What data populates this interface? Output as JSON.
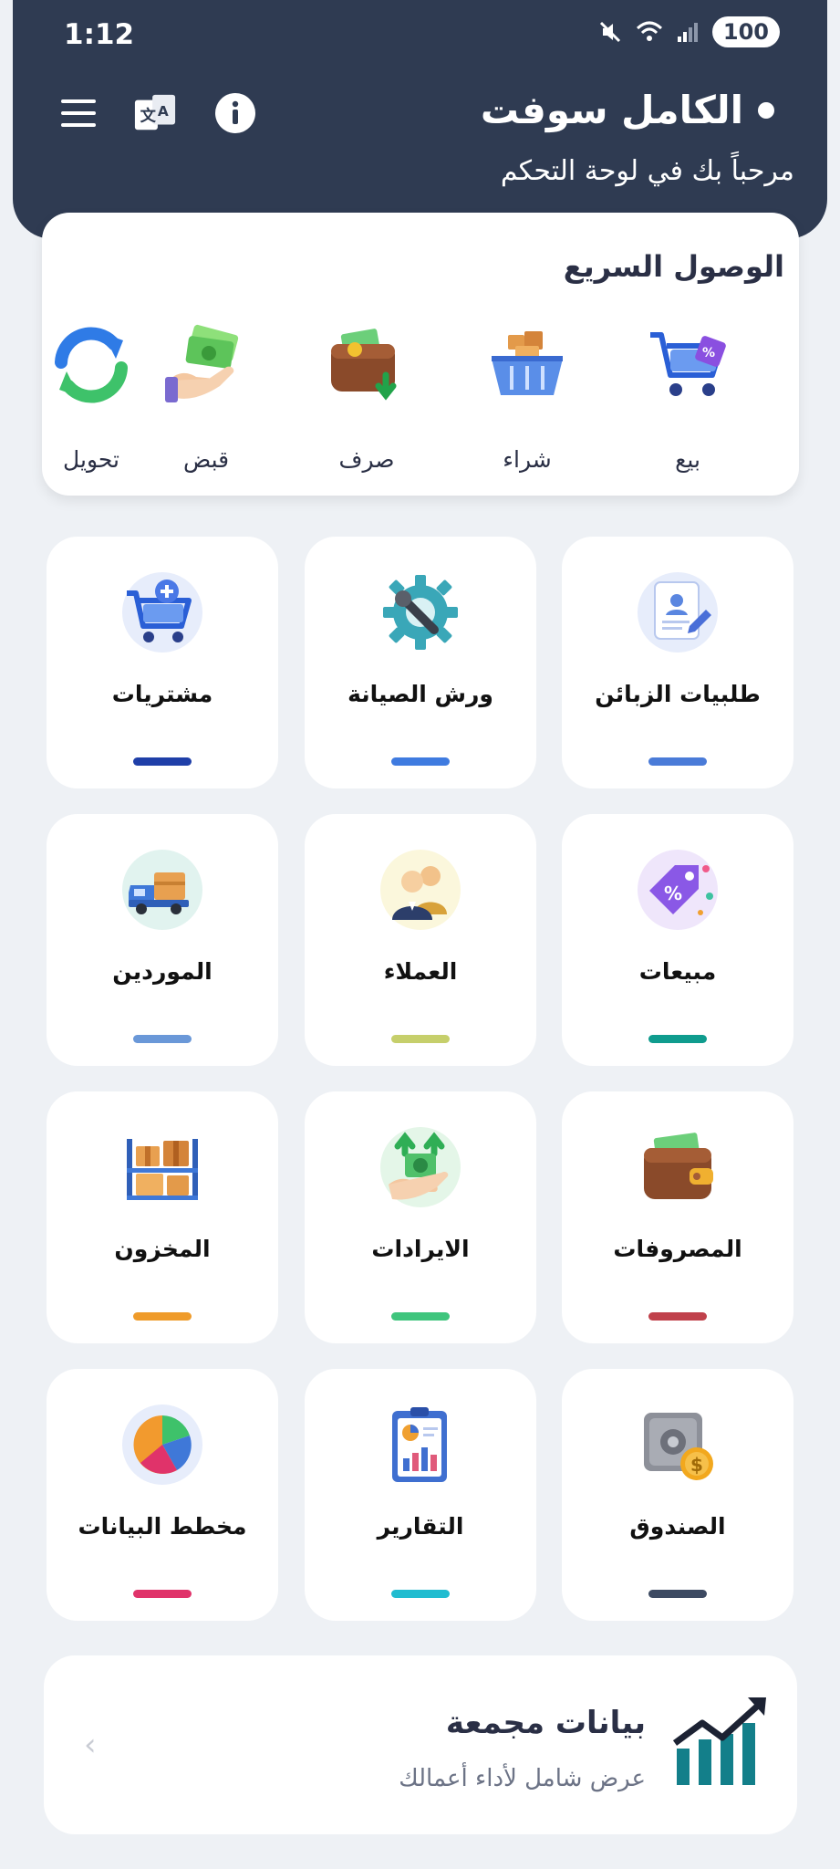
{
  "status_bar": {
    "time": "1:12",
    "battery": "100"
  },
  "header": {
    "title": "الكامل سوفت",
    "subtitle": "مرحباً بك في لوحة التحكم"
  },
  "quick_access": {
    "title": "الوصول السريع",
    "items": [
      {
        "label": "بيع",
        "icon": "cart-icon"
      },
      {
        "label": "شراء",
        "icon": "basket-icon"
      },
      {
        "label": "صرف",
        "icon": "wallet-out-icon"
      },
      {
        "label": "قبض",
        "icon": "hand-money-icon"
      },
      {
        "label": "تحويل",
        "icon": "transfer-icon"
      }
    ]
  },
  "tiles": [
    {
      "label": "طلبيات الزبائن",
      "icon": "document-icon",
      "bar_color": "#4a7bd8"
    },
    {
      "label": "ورش الصيانة",
      "icon": "gear-wrench-icon",
      "bar_color": "#3f7be0"
    },
    {
      "label": "مشتريات",
      "icon": "cart-plus-icon",
      "bar_color": "#1f3fa8"
    },
    {
      "label": "مبيعات",
      "icon": "tag-icon",
      "bar_color": "#0f9c8e"
    },
    {
      "label": "العملاء",
      "icon": "people-icon",
      "bar_color": "#c6cf6b"
    },
    {
      "label": "الموردين",
      "icon": "truck-icon",
      "bar_color": "#6a98d8"
    },
    {
      "label": "المصروفات",
      "icon": "wallet-icon",
      "bar_color": "#c0414b"
    },
    {
      "label": "الايرادات",
      "icon": "revenue-icon",
      "bar_color": "#3fc57d"
    },
    {
      "label": "المخزون",
      "icon": "boxes-icon",
      "bar_color": "#ef9b2a"
    },
    {
      "label": "الصندوق",
      "icon": "safe-icon",
      "bar_color": "#3d4a62"
    },
    {
      "label": "التقارير",
      "icon": "report-icon",
      "bar_color": "#21bcd0"
    },
    {
      "label": "مخطط البيانات",
      "icon": "pie-chart-icon",
      "bar_color": "#e0336a"
    }
  ],
  "summary": {
    "title": "بيانات مجمعة",
    "subtitle": "عرض شامل لأداء أعمالك",
    "chevron": "‹"
  }
}
